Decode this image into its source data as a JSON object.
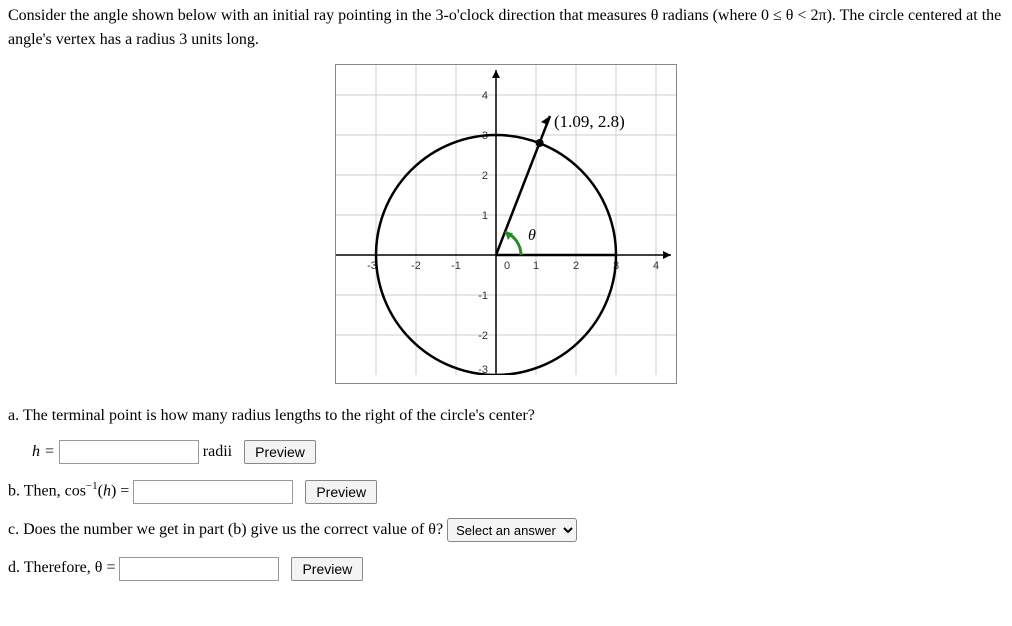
{
  "intro": "Consider the angle shown below with an initial ray pointing in the 3-o'clock direction that measures θ radians (where 0 ≤ θ < 2π). The circle centered at the angle's vertex has a radius 3 units long.",
  "chart_data": {
    "type": "diagram",
    "radius": 3,
    "xrange": [
      -3,
      4
    ],
    "yrange": [
      -3,
      4
    ],
    "xticks": [
      -3,
      -2,
      -1,
      0,
      1,
      2,
      3,
      4
    ],
    "yticks": [
      -3,
      -2,
      -1,
      1,
      2,
      3,
      4
    ],
    "terminal_point": {
      "x": 1.09,
      "y": 2.8
    },
    "point_label": "(1.09, 2.8)",
    "theta_symbol": "θ"
  },
  "parts": {
    "a": {
      "text": "a. The terminal point is how many radius lengths to the right of the circle's center?",
      "var": "h =",
      "unit": "radii",
      "preview": "Preview"
    },
    "b": {
      "text_prefix": "b. Then, cos",
      "exp": "−1",
      "text_mid": "(h) =",
      "preview": "Preview"
    },
    "c": {
      "text": "c. Does the number we get in part (b) give us the correct value of θ?",
      "select_placeholder": "Select an answer"
    },
    "d": {
      "text": "d. Therefore, θ =",
      "preview": "Preview"
    }
  }
}
